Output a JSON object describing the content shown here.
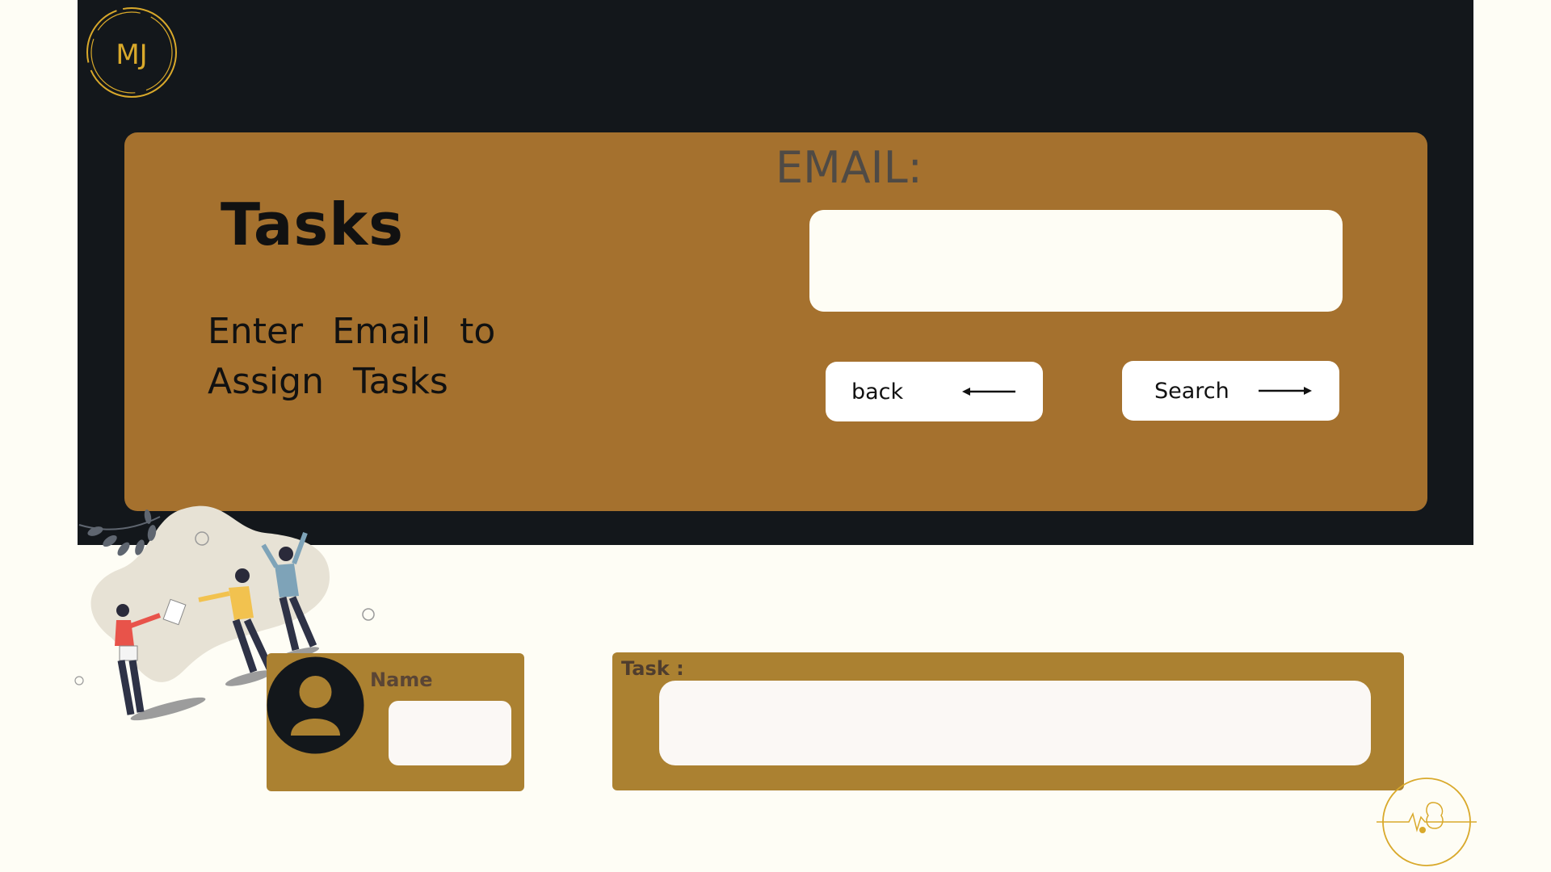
{
  "page": {
    "title": "Tasks",
    "subtitle": "Enter Email to Assign Tasks"
  },
  "logo": {
    "text": "MJ",
    "icon": "mj-monogram-icon"
  },
  "email": {
    "label": "EMAIL:",
    "value": "",
    "placeholder": ""
  },
  "buttons": {
    "back": {
      "label": "back",
      "icon": "arrow-left-icon"
    },
    "search": {
      "label": "Search",
      "icon": "arrow-right-icon"
    }
  },
  "name_card": {
    "label": "Name",
    "value": "",
    "icon": "user-avatar-icon"
  },
  "task_card": {
    "label": "Task :",
    "value": ""
  },
  "colors": {
    "background": "#fefdf5",
    "dark_panel": "#13171b",
    "card_brown": "#a5712e",
    "gold_card": "#ab8131",
    "logo_gold": "#d9a92b"
  }
}
